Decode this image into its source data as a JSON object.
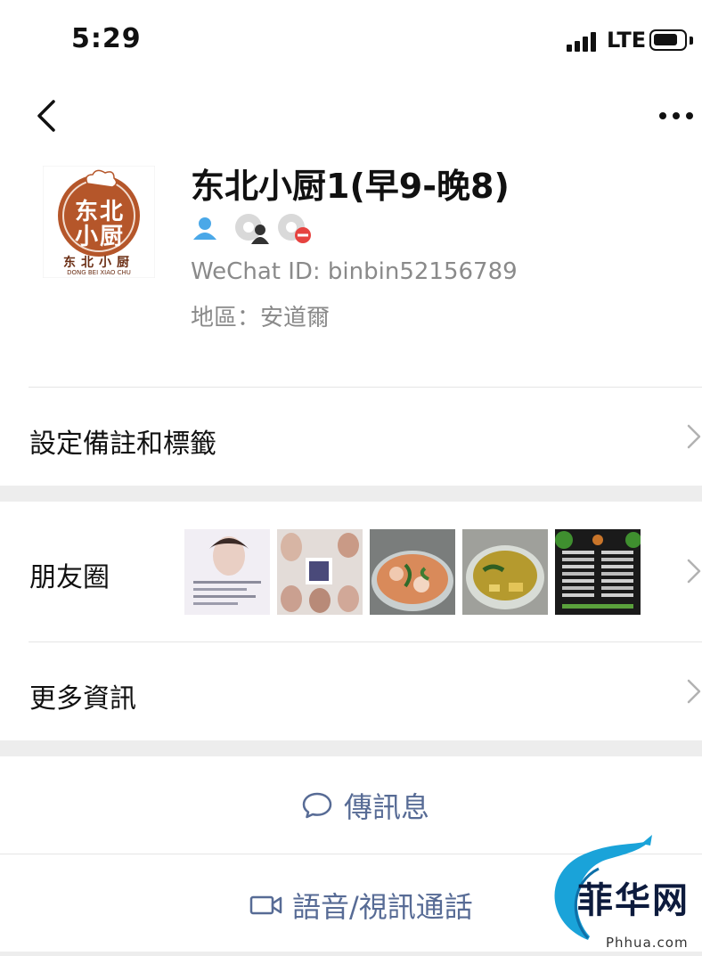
{
  "status_bar": {
    "time": "5:29",
    "network": "LTE"
  },
  "profile": {
    "avatar_text_main": "东北小厨",
    "avatar_text_sub": "东北小厨",
    "avatar_text_en": "DONG BEI XIAO CHU",
    "name": "东北小厨1(早9-晚8)",
    "wechat_id": "WeChat ID: binbin52156789",
    "region": "地區：安道爾",
    "status_icons": [
      "person-icon",
      "friends-icon",
      "blocked-moments-icon"
    ]
  },
  "menu": {
    "remarks_label": "設定備註和標籤",
    "moments_label": "朋友圈",
    "more_info_label": "更多資訊"
  },
  "actions": {
    "message_label": "傳訊息",
    "call_label": "語音/視訊通話"
  },
  "watermark": {
    "text": "菲华网",
    "url": "Phhua.com"
  },
  "colors": {
    "link": "#576b95",
    "secondary_text": "#8a8a8a",
    "separator": "#ededed"
  }
}
